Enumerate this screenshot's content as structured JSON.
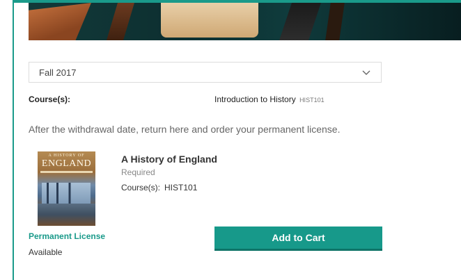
{
  "term_select": {
    "selected": "Fall 2017",
    "icon": "chevron-down-icon"
  },
  "courses": {
    "label": "Course(s):",
    "name": "Introduction to History",
    "code": "HIST101"
  },
  "instruction": "After the withdrawal date, return here and order your permanent license.",
  "book": {
    "cover": {
      "series": "A HISTORY OF",
      "title": "ENGLAND"
    },
    "title": "A History of England",
    "requirement": "Required",
    "course_label": "Course(s):",
    "course_code": "HIST101",
    "license_type": "Permanent License",
    "availability": "Available",
    "add_to_cart_label": "Add to Cart"
  },
  "colors": {
    "accent": "#17998a",
    "accent_dark": "#0f7468",
    "frame": "#1a9a8a"
  }
}
